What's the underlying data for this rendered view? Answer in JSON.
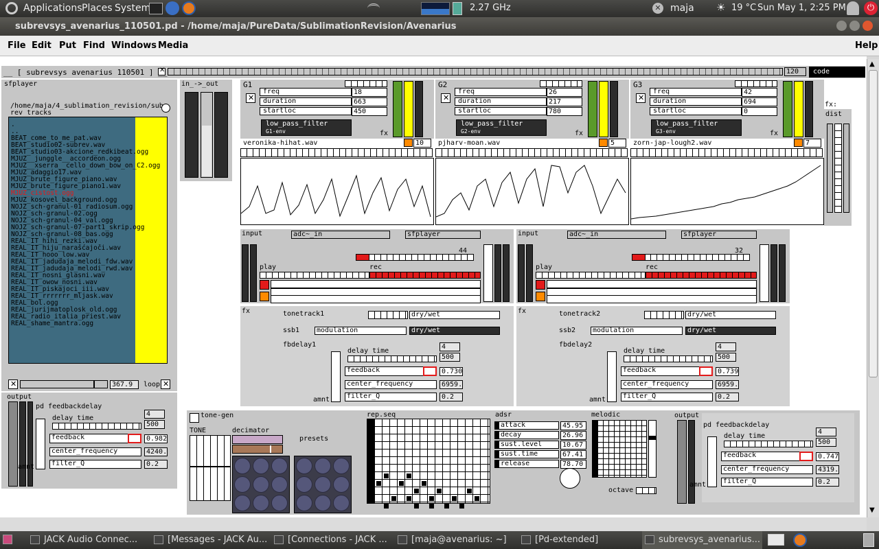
{
  "topbar": {
    "applications": "Applications",
    "places": "Places",
    "system": "System",
    "cpu": "2.27 GHz",
    "user": "maja",
    "weather": "19 °C",
    "clock": "Sun May  1,  2:25 PM"
  },
  "window": {
    "title": "subrevsys_avenarius_110501.pd  - /home/maja/PureData/SublimationRevision/Avenarius"
  },
  "menu": {
    "file": "File",
    "edit": "Edit",
    "put": "Put",
    "find": "Find",
    "windows": "Windows",
    "media": "Media",
    "help": "Help"
  },
  "patch": {
    "header": "__ [ subrevsys avenarius 110501 ] __",
    "tempo": "120",
    "mode": "code",
    "sfplayer": {
      "title": "sfplayer",
      "path": "/home/maja/4_sublimation_revision/sub",
      "subtitle": "rev tracks",
      "files": [
        ".",
        "..",
        "BEAT_come_to_me_pat.wav",
        "BEAT_studio02-subrev.wav",
        "BEAT_studio03-akcione_redkibeat.ogg",
        "MJUZ__junggle__accordeon.ogg",
        "MJUZ__xserra__cello_down_bow_on_C2.ogg",
        "MJUZ_adaggio17.wav",
        "MJUZ_brute_figure_piano.wav",
        "MJUZ_brute_figure_piano1.wav",
        "MJUZ_cistost.ogg",
        "MJUZ_kosovel_background.ogg",
        "NOJZ_sch-granul-01_radiosum.ogg",
        "NOJZ_sch-granul-02.ogg",
        "NOJZ_sch-granul-04_val.ogg",
        "NOJZ_sch-granul-07-part1_skrip.ogg",
        "NOJZ_sch-granul-08_bas.ogg",
        "REAL_IT_hihi_rezki.wav",
        "REAL_IT_hiju_narašćajoči.wav",
        "REAL_IT_hooo_low.wav",
        "REAL_IT_jadudaja_melodi_fdw.wav",
        "REAL_IT_jadudaja_melodi_rwd.wav",
        "REAL_IT_nosni_glasni.wav",
        "REAL_IT_owow_nosni.wav",
        "REAL_IT_piskajoci_iii.wav",
        "REAL_IT_rrrrrrr_mljask.wav",
        "REAL_bol.ogg",
        "REAL_jurijmatoplosk_old.ogg",
        "REAL_radio_italia_priest.wav",
        "REAL_shame_mantra.ogg"
      ],
      "selected_index": 10,
      "position": "367.9",
      "loop": "loop"
    },
    "inout": "in_->_out",
    "grains": [
      {
        "label": "G1",
        "freq": "18",
        "duration": "663",
        "startloc": "450",
        "filter": "low_pass_filter",
        "env": "G1-env",
        "fx": "fx",
        "count": "10",
        "sample": "veronika-hihat.wav"
      },
      {
        "label": "G2",
        "freq": "26",
        "duration": "217",
        "startloc": "780",
        "filter": "low_pass_filter",
        "env": "G2-env",
        "fx": "fx",
        "count": "5",
        "sample": "pjharv-moan.wav"
      },
      {
        "label": "G3",
        "freq": "42",
        "duration": "694",
        "startloc": "0",
        "filter": "low_pass_filter",
        "env": "G3-env",
        "fx": "fx",
        "count": "7",
        "sample": "zorn-jap-lough2.wav"
      }
    ],
    "field_labels": {
      "freq": "freq",
      "duration": "duration",
      "startloc": "startloc"
    },
    "fxdist": {
      "fx": "fx:",
      "dist": "dist"
    },
    "loopers": [
      {
        "input": "input",
        "adc": "adc~_in",
        "sf": "sfplayer",
        "counter": "44",
        "play": "play",
        "rec": "rec",
        "fx": "fx",
        "tonetrack": "tonetrack1",
        "ssb": "ssb1",
        "modulation": "modulation",
        "drywet": "dry/wet",
        "fbdelay": "fbdelay1",
        "delay_time": "delay time",
        "delay_val": "4",
        "delay_val2": "500",
        "feedback": "feedback",
        "feedback_val": "0.730",
        "center": "center_frequency",
        "center_val": "6959.",
        "filter_q": "filter_Q",
        "q_val": "0.2",
        "amnt": "amnt"
      },
      {
        "input": "input",
        "adc": "adc~_in",
        "sf": "sfplayer",
        "counter": "32",
        "play": "play",
        "rec": "rec",
        "fx": "fx",
        "tonetrack": "tonetrack2",
        "ssb": "ssb2",
        "modulation": "modulation",
        "drywet": "dry/wet",
        "fbdelay": "fbdelay2",
        "delay_time": "delay time",
        "delay_val": "4",
        "delay_val2": "500",
        "feedback": "feedback",
        "feedback_val": "0.739",
        "center": "center_frequency",
        "center_val": "6959.",
        "filter_q": "filter_Q",
        "q_val": "0.2",
        "amnt": "amnt"
      }
    ],
    "out_left": {
      "output": "output",
      "pd": "pd feedbackdelay",
      "delay_time": "delay time",
      "delay_val": "4",
      "delay_val2": "500",
      "feedback": "feedback",
      "feedback_val": "0.982",
      "center": "center_frequency",
      "center_val": "4240.",
      "filter_q": "filter_Q",
      "q_val": "0.2",
      "amnt": "amnt"
    },
    "out_right": {
      "output": "output",
      "pd": "pd feedbackdelay",
      "delay_time": "delay time",
      "delay_val": "4",
      "delay_val2": "500",
      "feedback": "feedback",
      "feedback_val": "0.747",
      "center": "center_frequency",
      "center_val": "4319.",
      "filter_q": "filter_Q",
      "q_val": "0.2",
      "amnt": "amnt"
    },
    "tonegen": {
      "title": "tone-gen",
      "tone": "TONE",
      "decimator": "decimator",
      "presets": "presets",
      "repseq": "rep.seq",
      "adsr": "adsr",
      "melodic": "melodic",
      "octave": "octave",
      "adsr_rows": [
        {
          "label": "attack",
          "val": "45.95"
        },
        {
          "label": "decay",
          "val": "26.96"
        },
        {
          "label": "sust.level",
          "val": "10.67"
        },
        {
          "label": "sust.time",
          "val": "67.41"
        },
        {
          "label": "release",
          "val": "78.70"
        }
      ]
    }
  },
  "taskbar": [
    {
      "label": "JACK Audio Connec..."
    },
    {
      "label": "[Messages - JACK Au..."
    },
    {
      "label": "[Connections - JACK ..."
    },
    {
      "label": "[maja@avenarius: ~]"
    },
    {
      "label": "[Pd-extended]"
    },
    {
      "label": "subrevsys_avenarius..."
    }
  ],
  "colors": {
    "teal": "#3e6b80",
    "yellow": "#ffff00",
    "red": "#e21a1a",
    "orange": "#ff8a00",
    "green": "#5a9a2a",
    "panel": "#c6c6c6"
  }
}
